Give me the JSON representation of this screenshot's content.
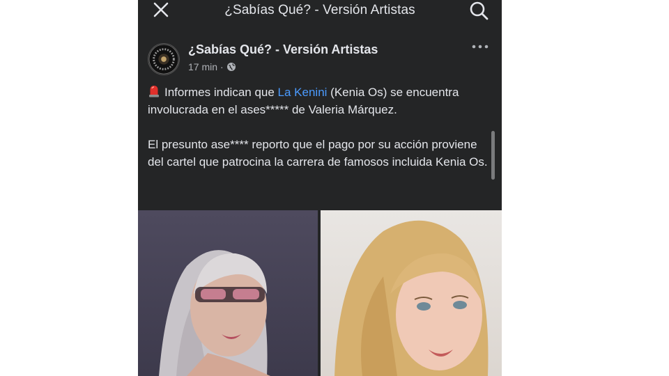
{
  "topbar": {
    "title": "¿Sabías Qué? - Versión Artistas",
    "close_icon": "close-icon",
    "search_icon": "search-icon"
  },
  "post": {
    "page_name": "¿Sabías Qué? - Versión Artistas",
    "time": "17 min",
    "separator": "·",
    "privacy_icon": "globe-icon",
    "more_icon": "more-options-icon",
    "avatar_icon": "page-avatar",
    "text": {
      "siren_icon": "siren-emoji",
      "p1_before": "Informes indican que ",
      "mention": "La Kenini",
      "p1_after": " (Kenia Os) se encuentra involucrada en el ases***** de Valeria Márquez.",
      "p2": "El presunto ase**** reporto que el pago por su acción proviene del cartel que patrocina la carrera de famosos incluida Kenia Os."
    }
  },
  "colors": {
    "background": "#242526",
    "text": "#e4e6eb",
    "secondary_text": "#b0b3b8",
    "mention": "#4b9bff"
  }
}
